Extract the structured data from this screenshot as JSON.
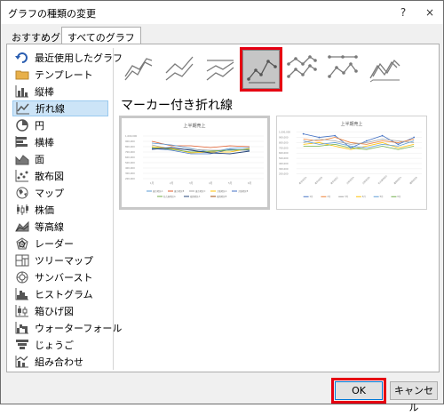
{
  "dialog": {
    "title": "グラフの種類の変更",
    "help": "?",
    "close": "×"
  },
  "tabs": [
    {
      "label": "おすすめグラフ"
    },
    {
      "label": "すべてのグラフ"
    }
  ],
  "sidebar": {
    "items": [
      {
        "label": "最近使用したグラフ",
        "icon": "recent-icon"
      },
      {
        "label": "テンプレート",
        "icon": "folder-icon"
      },
      {
        "label": "縦棒",
        "icon": "column-chart-icon"
      },
      {
        "label": "折れ線",
        "icon": "line-chart-icon",
        "selected": true
      },
      {
        "label": "円",
        "icon": "pie-chart-icon"
      },
      {
        "label": "横棒",
        "icon": "bar-chart-icon"
      },
      {
        "label": "面",
        "icon": "area-chart-icon"
      },
      {
        "label": "散布図",
        "icon": "scatter-chart-icon"
      },
      {
        "label": "マップ",
        "icon": "map-chart-icon"
      },
      {
        "label": "株価",
        "icon": "stock-chart-icon"
      },
      {
        "label": "等高線",
        "icon": "surface-chart-icon"
      },
      {
        "label": "レーダー",
        "icon": "radar-chart-icon"
      },
      {
        "label": "ツリーマップ",
        "icon": "treemap-icon"
      },
      {
        "label": "サンバースト",
        "icon": "sunburst-icon"
      },
      {
        "label": "ヒストグラム",
        "icon": "histogram-icon"
      },
      {
        "label": "箱ひげ図",
        "icon": "box-whisker-icon"
      },
      {
        "label": "ウォーターフォール",
        "icon": "waterfall-icon"
      },
      {
        "label": "じょうご",
        "icon": "funnel-icon"
      },
      {
        "label": "組み合わせ",
        "icon": "combo-chart-icon"
      }
    ]
  },
  "main": {
    "subtitle": "マーカー付き折れ線",
    "preview_title": "上半期売上",
    "selected_subtype_index": 3
  },
  "footer": {
    "ok": "OK",
    "cancel": "キャンセル"
  },
  "colors": {
    "highlight": "#e60012",
    "selection_bg": "#cce4f7",
    "accent": "#0078d7"
  }
}
